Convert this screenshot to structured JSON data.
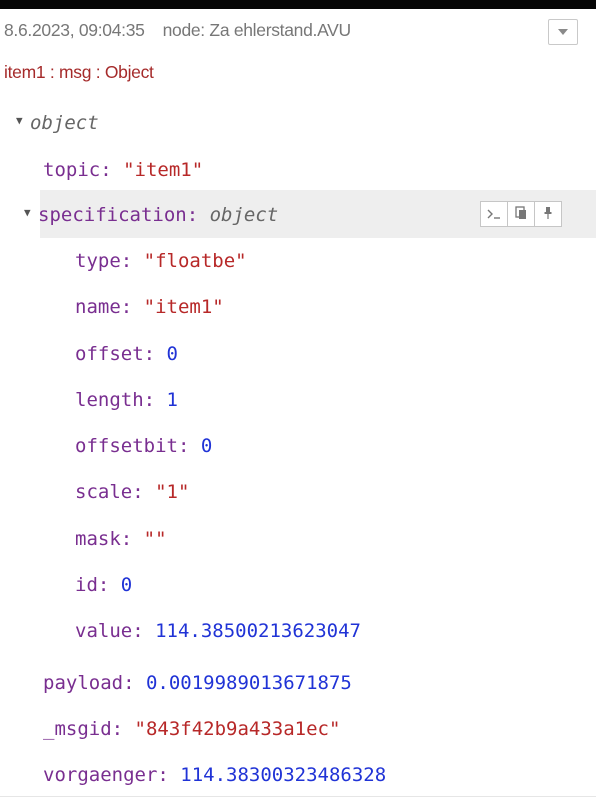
{
  "header": {
    "timestamp": "8.6.2023, 09:04:35",
    "node": "node: Za ehlerstand.AVU",
    "msg_type": "item1 : msg : Object"
  },
  "tree": {
    "root_label": "object",
    "topic": {
      "key": "topic",
      "value": "\"item1\""
    },
    "specification": {
      "key": "specification",
      "type": "object",
      "fields": [
        {
          "key": "type",
          "value": "\"floatbe\"",
          "kind": "string"
        },
        {
          "key": "name",
          "value": "\"item1\"",
          "kind": "string"
        },
        {
          "key": "offset",
          "value": "0",
          "kind": "number"
        },
        {
          "key": "length",
          "value": "1",
          "kind": "number"
        },
        {
          "key": "offsetbit",
          "value": "0",
          "kind": "number"
        },
        {
          "key": "scale",
          "value": "\"1\"",
          "kind": "string"
        },
        {
          "key": "mask",
          "value": "\"\"",
          "kind": "string"
        },
        {
          "key": "id",
          "value": "0",
          "kind": "number"
        },
        {
          "key": "value",
          "value": "114.38500213623047",
          "kind": "number"
        }
      ]
    },
    "payload": {
      "key": "payload",
      "value": "0.0019989013671875"
    },
    "msgid": {
      "key": "_msgid",
      "value": "\"843f42b9a433a1ec\""
    },
    "vorgaenger": {
      "key": "vorgaenger",
      "value": "114.38300323486328"
    }
  },
  "colors": {
    "key": "#792e90",
    "string": "#b72828",
    "number": "#2033d6",
    "meta_text": "#777777",
    "msg_type": "#a52a2a",
    "hover_row": "#eeeeee"
  },
  "icons": {
    "meta_button": "chevron-down-icon",
    "copy_path": "terminal-prompt-icon",
    "copy_value": "clipboard-icon",
    "pin": "pin-icon"
  }
}
